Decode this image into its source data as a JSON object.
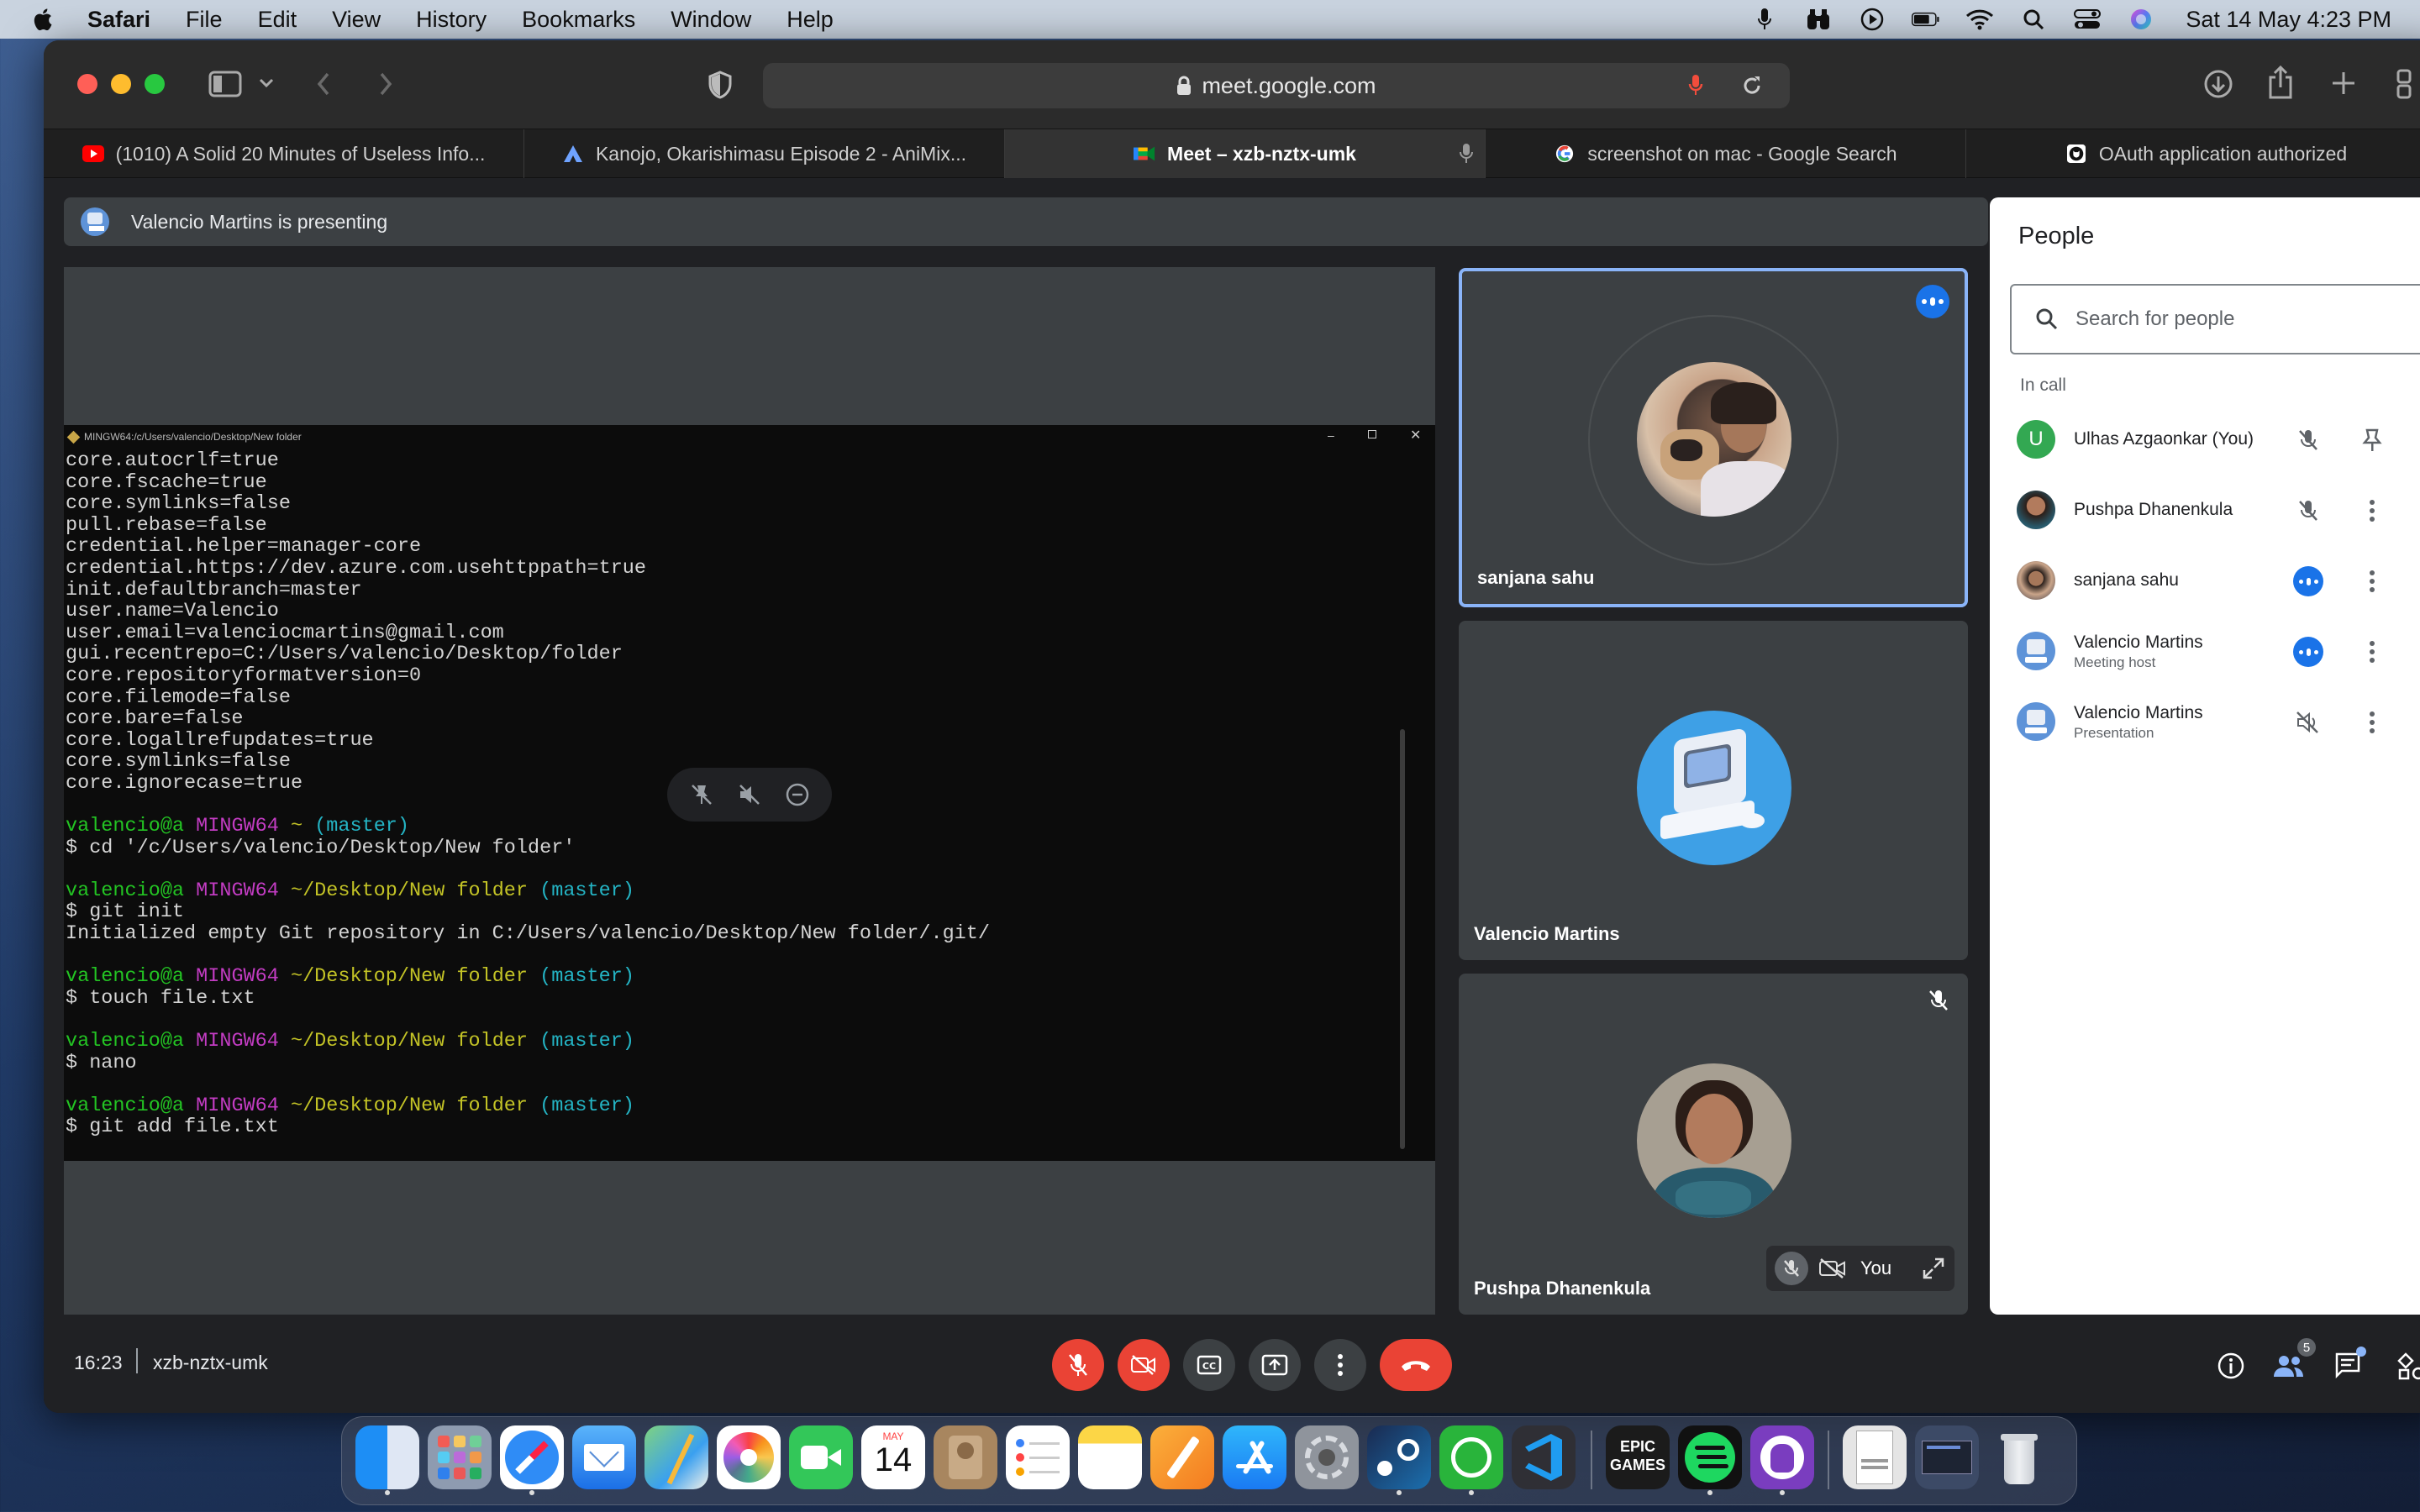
{
  "menubar": {
    "app": "Safari",
    "items": [
      "File",
      "Edit",
      "View",
      "History",
      "Bookmarks",
      "Window",
      "Help"
    ],
    "clock": "Sat 14 May  4:23 PM"
  },
  "browser": {
    "url": "meet.google.com",
    "tabs": [
      {
        "label": "(1010) A Solid 20 Minutes of Useless Info...",
        "icon": "youtube-icon"
      },
      {
        "label": "Kanojo, Okarishimasu Episode 2 - AniMix...",
        "icon": "animix-icon"
      },
      {
        "label": "Meet – xzb-nztx-umk",
        "icon": "google-meet-icon",
        "active": true
      },
      {
        "label": "screenshot on mac - Google Search",
        "icon": "google-icon"
      },
      {
        "label": "OAuth application authorized",
        "icon": "github-icon"
      }
    ]
  },
  "meet": {
    "presenting_banner": "Valencio Martins is presenting",
    "terminal": {
      "title": "MINGW64:/c/Users/valencio/Desktop/New folder",
      "config_lines": [
        "core.autocrlf=true",
        "core.fscache=true",
        "core.symlinks=false",
        "pull.rebase=false",
        "credential.helper=manager-core",
        "credential.https://dev.azure.com.usehttppath=true",
        "init.defaultbranch=master",
        "user.name=Valencio",
        "user.email=valenciocmartins@gmail.com",
        "gui.recentrepo=C:/Users/valencio/Desktop/folder",
        "core.repositoryformatversion=0",
        "core.filemode=false",
        "core.bare=false",
        "core.logallrefupdates=true",
        "core.symlinks=false",
        "core.ignorecase=true"
      ],
      "user": "valencio@a",
      "host": "MINGW64",
      "branch": "(master)",
      "sessions": [
        {
          "path": "~",
          "cmd": "$ cd '/c/Users/valencio/Desktop/New folder'",
          "out": ""
        },
        {
          "path": "~/Desktop/New folder",
          "cmd": "$ git init",
          "out": "Initialized empty Git repository in C:/Users/valencio/Desktop/New folder/.git/"
        },
        {
          "path": "~/Desktop/New folder",
          "cmd": "$ touch file.txt",
          "out": ""
        },
        {
          "path": "~/Desktop/New folder",
          "cmd": "$ nano",
          "out": ""
        },
        {
          "path": "~/Desktop/New folder",
          "cmd": "$ git add file.txt",
          "out": ""
        }
      ]
    },
    "tiles": [
      {
        "name": "sanjana sahu"
      },
      {
        "name": "Valencio Martins"
      },
      {
        "name": "Pushpa Dhanenkula"
      }
    ],
    "you_label": "You",
    "people_panel": {
      "title": "People",
      "search_placeholder": "Search for people",
      "section": "In call",
      "participants": [
        {
          "name": "Ulhas Azgaonkar (You)",
          "sub": "",
          "initial": "U",
          "status": "muted"
        },
        {
          "name": "Pushpa Dhanenkula",
          "sub": "",
          "status": "muted"
        },
        {
          "name": "sanjana sahu",
          "sub": "",
          "status": "speaking"
        },
        {
          "name": "Valencio Martins",
          "sub": "Meeting host",
          "status": "speaking"
        },
        {
          "name": "Valencio Martins",
          "sub": "Presentation",
          "status": "audio-off"
        }
      ]
    },
    "bottom": {
      "time": "16:23",
      "code": "xzb-nztx-umk",
      "people_count": "5"
    }
  },
  "dock": {
    "calendar_month": "MAY",
    "calendar_day": "14",
    "epic_label": "EPIC\nGAMES"
  },
  "colors": {
    "accent_blue": "#8ab4f8",
    "meet_red": "#ea4335",
    "tile_bg": "#3c4043"
  }
}
